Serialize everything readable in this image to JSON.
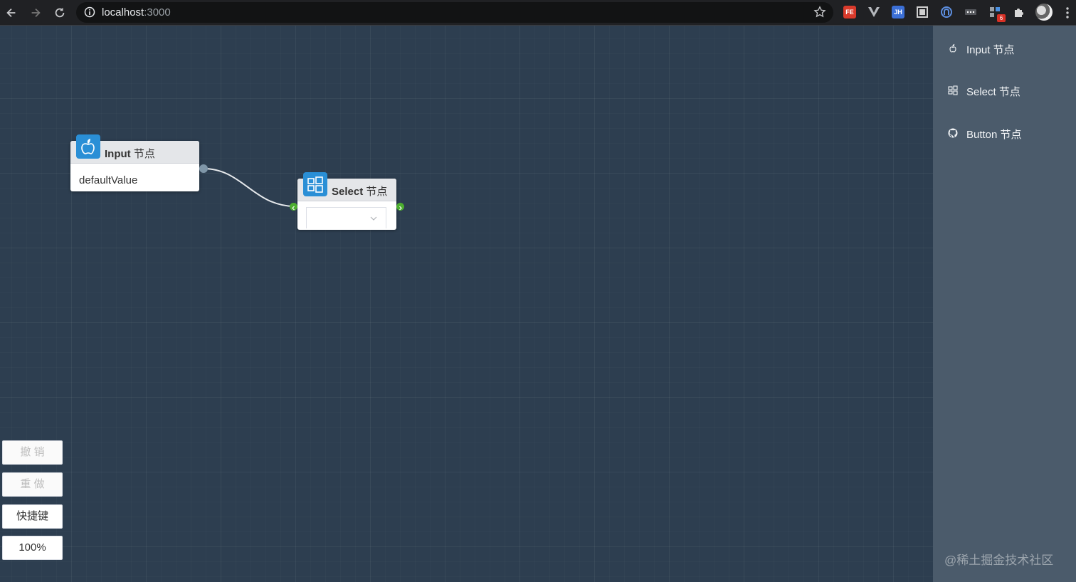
{
  "browser": {
    "url_host": "localhost",
    "url_port": ":3000",
    "extensions": {
      "fe_label": "FE",
      "jh_label": "JH",
      "badge_count": "6"
    },
    "icons": [
      "back-icon",
      "forward-icon",
      "reload-icon",
      "info-icon",
      "bookmark-star-icon",
      "vue-devtools-icon",
      "puzzle-icon",
      "menu-dots-icon"
    ]
  },
  "canvas": {
    "nodes": {
      "input": {
        "title": "Input",
        "title_zh": "节点",
        "value": "defaultValue",
        "icon": "apple-icon"
      },
      "select": {
        "title": "Select",
        "title_zh": "节点",
        "value": "",
        "icon": "windows-icon"
      }
    },
    "controls": {
      "undo": "撤 销",
      "redo": "重 做",
      "shortcuts": "快捷键",
      "zoom": "100%"
    }
  },
  "sidebar": {
    "items": [
      {
        "label": "Input 节点",
        "icon": "apple-icon"
      },
      {
        "label": "Select 节点",
        "icon": "windows-icon"
      },
      {
        "label": "Button 节点",
        "icon": "github-icon"
      }
    ]
  },
  "watermark": "@稀土掘金技术社区",
  "colors": {
    "canvas_bg": "#2d3e50",
    "sidebar_bg": "#4b5b6b",
    "node_icon_bg": "#2a8fd6",
    "port_green": "#4cae2f"
  }
}
